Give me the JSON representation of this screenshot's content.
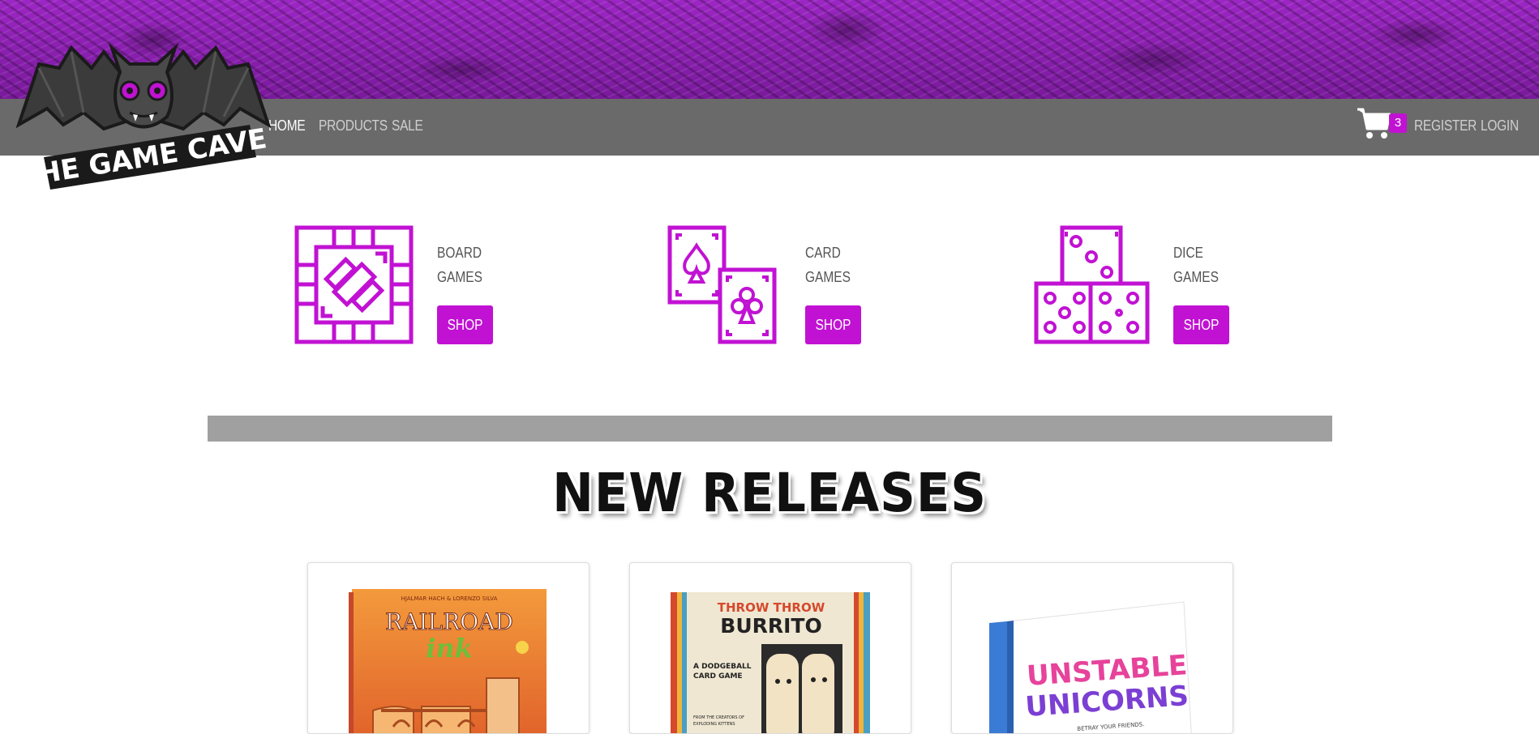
{
  "brand": {
    "name": "THE GAME CAVE"
  },
  "nav": {
    "links": [
      {
        "label": "HOME",
        "active": true
      },
      {
        "label": "PRODUCTS",
        "active": false
      },
      {
        "label": "SALE",
        "active": false
      }
    ],
    "cart_count": "3",
    "register_label": "REGISTER",
    "login_label": "LOGIN"
  },
  "categories": [
    {
      "line1": "BOARD",
      "line2": "GAMES",
      "button": "SHOP",
      "icon": "board-game-icon"
    },
    {
      "line1": "CARD",
      "line2": "GAMES",
      "button": "SHOP",
      "icon": "playing-cards-icon"
    },
    {
      "line1": "DICE",
      "line2": "GAMES",
      "button": "SHOP",
      "icon": "dice-icon"
    }
  ],
  "new_releases": {
    "title": "NEW RELEASES",
    "products": [
      {
        "title_line1": "RAILROAD",
        "title_line2": "ink",
        "top_text": "HJALMAR HACH & LORENZO SILVA"
      },
      {
        "title_line1": "THROW THROW",
        "title_line2": "BURRITO",
        "sub1": "A DODGEBALL",
        "sub2": "CARD GAME",
        "sub3": "FROM THE CREATORS OF",
        "sub4": "EXPLODING KITTENS"
      },
      {
        "title_line1": "UNSTABLE",
        "title_line2": "UNICORNS",
        "sub1": "BETRAY YOUR FRIENDS."
      }
    ]
  },
  "colors": {
    "accent": "#c112d3",
    "navbar": "#6a6a6a",
    "divider": "#a0a0a0"
  }
}
